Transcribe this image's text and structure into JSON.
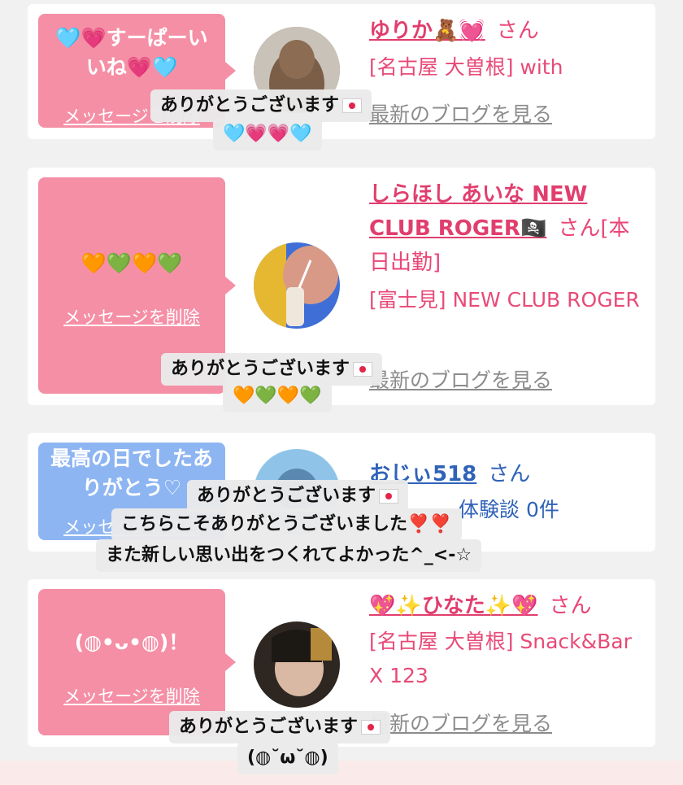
{
  "delete_label": "メッセージを削除",
  "san_label": "さん",
  "messages": [
    {
      "bubble_text": "🩵💗すーぱーい\nいね💗🩵",
      "name": "ゆりか🧸💓",
      "name_suffix": "",
      "info": "[名古屋 大曽根] with",
      "blog_label": "最新のブログを見る",
      "overlay": [
        "ありがとうございます",
        "🩵💗💗🩵"
      ]
    },
    {
      "bubble_text": "🧡💚🧡💚",
      "name": "しらほし あいな NEW CLUB ROGER🏴‍☠️",
      "name_suffix": "[本日出勤]",
      "info": "[富士見] NEW CLUB ROGER",
      "blog_label": "最新のブログを見る",
      "overlay": [
        "ありがとうございます",
        "🧡💚🧡💚"
      ]
    },
    {
      "bubble_text": "最高の日でしたあ\nりがとう♡",
      "name": "おじぃ518",
      "name_suffix": "",
      "info": "体験談 0件",
      "overlay": [
        "ありがとうございます",
        "こちらこそありがとうございました❣️❣️",
        "また新しい思い出をつくれてよかった^_<-☆"
      ]
    },
    {
      "bubble_text": "(◍•ᴗ•◍)！",
      "name": "💖✨ひなた✨💖",
      "name_suffix": "",
      "info": "[名古屋 大曽根] Snack&Bar X 123",
      "blog_label": "最新のブログを見る",
      "overlay": [
        "ありがとうございます",
        "(◍˘ω˘◍)"
      ]
    }
  ],
  "colors": {
    "accent_pink": "#ea4576",
    "bubble_pink": "#f58fa6",
    "bubble_blue": "#8db5f2",
    "link_blue": "#2f63b8"
  }
}
